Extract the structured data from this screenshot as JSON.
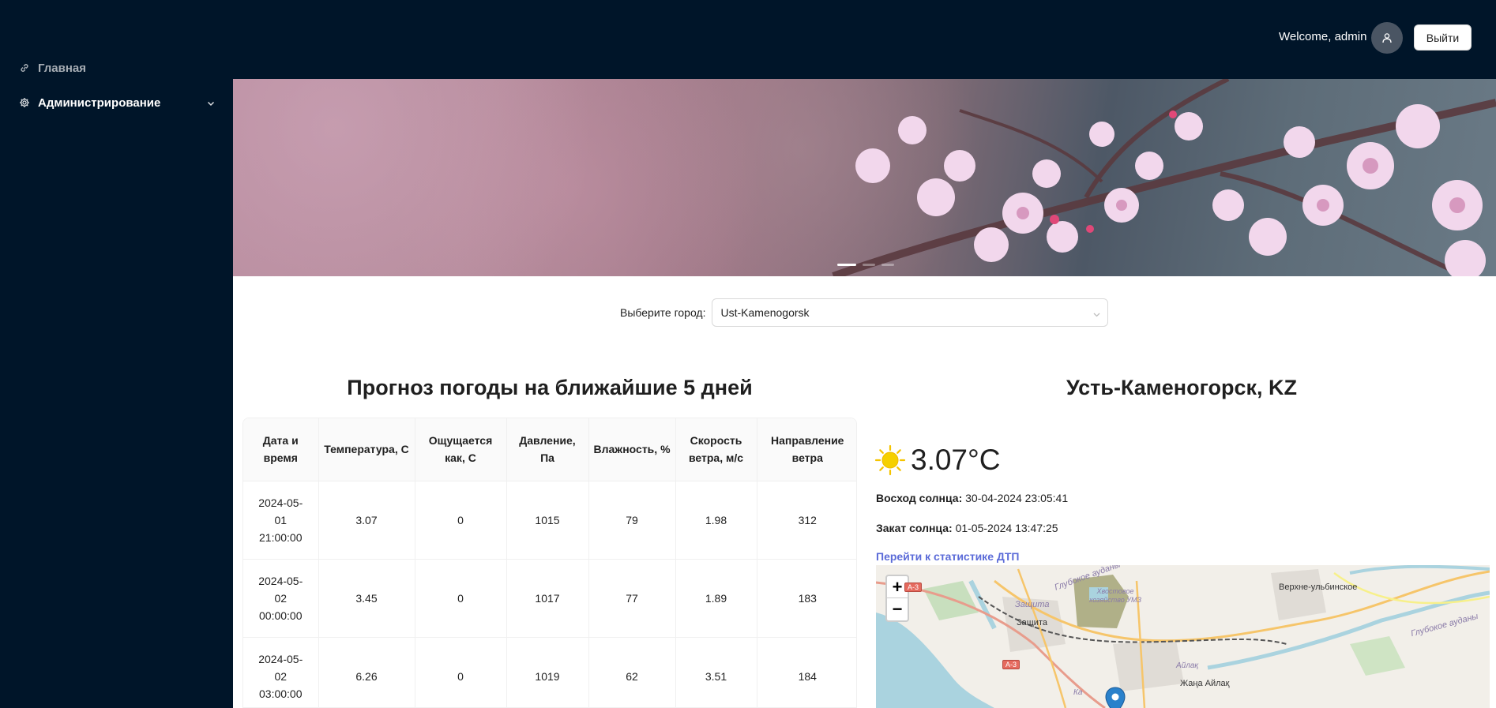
{
  "sidebar": {
    "items": [
      {
        "label": "Главная",
        "icon": "link-icon"
      },
      {
        "label": "Администрирование",
        "icon": "gear-icon"
      }
    ]
  },
  "header": {
    "welcome": "Welcome, admin",
    "logout_label": "Выйти"
  },
  "carousel": {
    "slide_count": 3,
    "active_slide": 1
  },
  "city_select": {
    "label": "Выберите город:",
    "value": "Ust-Kamenogorsk"
  },
  "forecast": {
    "title": "Прогноз погоды на ближайшие 5 дней",
    "columns": [
      "Дата и время",
      "Температура, С",
      "Ощущается как, С",
      "Давление, Па",
      "Влажность, %",
      "Скорость ветра, м/с",
      "Направление ветра"
    ],
    "rows": [
      {
        "date_line1": "2024-05-",
        "date_line2": "01",
        "time": "21:00:00",
        "temp": "3.07",
        "feels": "0",
        "pressure": "1015",
        "humidity": "79",
        "wind_speed": "1.98",
        "wind_dir": "312"
      },
      {
        "date_line1": "2024-05-",
        "date_line2": "02",
        "time": "00:00:00",
        "temp": "3.45",
        "feels": "0",
        "pressure": "1017",
        "humidity": "77",
        "wind_speed": "1.89",
        "wind_dir": "183"
      },
      {
        "date_line1": "2024-05-",
        "date_line2": "02",
        "time": "03:00:00",
        "temp": "6.26",
        "feels": "0",
        "pressure": "1019",
        "humidity": "62",
        "wind_speed": "3.51",
        "wind_dir": "184"
      }
    ]
  },
  "current": {
    "city": "Усть-Каменогорск, KZ",
    "temperature": "3.07°C",
    "icon": "sun-icon",
    "sunrise_label": "Восход солнца:",
    "sunrise_value": "30-04-2024 23:05:41",
    "sunset_label": "Закат солнца:",
    "sunset_value": "01-05-2024 13:47:25",
    "dtp_link": "Перейти к статистике ДТП"
  },
  "map": {
    "zoom_in": "+",
    "zoom_out": "−",
    "labels": {
      "zashchita_top": "Защита",
      "zashchita": "Защита",
      "khvostovoe": "Хвостовое хозяйство УМЗ",
      "verkhne": "Верхне-ульбинское",
      "glubokoe_top": "Глубокое ауданы",
      "glubokoe_right": "Глубокое ауданы",
      "aylak": "Айлақ",
      "zhana_aylak": "Жаңа Айлақ",
      "k": "Ка"
    },
    "road_a3_top": "А-3",
    "road_a3": "А-3"
  },
  "colors": {
    "sidebar_bg": "#001529",
    "link": "#5b6bd8",
    "sun": "#f5c400"
  }
}
